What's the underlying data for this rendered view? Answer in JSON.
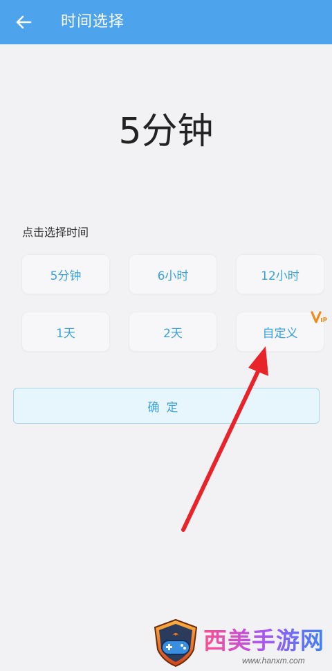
{
  "header": {
    "title": "时间选择",
    "back_icon": "arrow-left-icon"
  },
  "selected_time": "5分钟",
  "section_label": "点击选择时间",
  "options": [
    {
      "label": "5分钟"
    },
    {
      "label": "6小时"
    },
    {
      "label": "12小时"
    },
    {
      "label": "1天"
    },
    {
      "label": "2天"
    },
    {
      "label": "自定义",
      "badge": "VIP"
    }
  ],
  "confirm_label": "确定",
  "watermark": {
    "site_name": "西美手游网",
    "url": "www.hanxm.com"
  },
  "colors": {
    "header": "#4da3ec",
    "accent": "#3aa2d9",
    "arrow": "#e8232a",
    "vip": "#f08a1c"
  }
}
